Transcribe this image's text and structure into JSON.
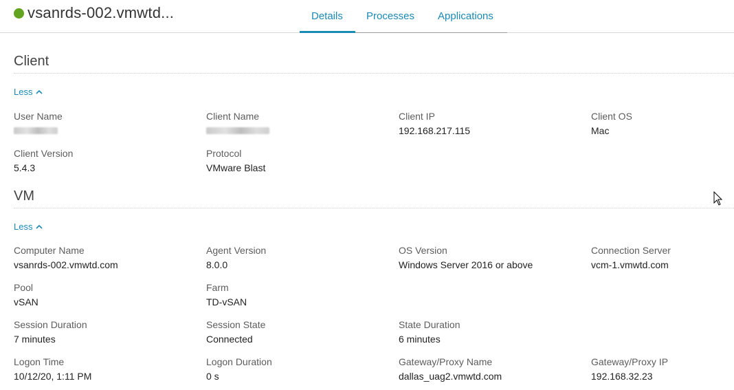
{
  "header": {
    "host_name": "vsanrds-002.vmwtd...",
    "status_color": "#62a420",
    "tabs": [
      {
        "label": "Details",
        "active": true
      },
      {
        "label": "Processes",
        "active": false
      },
      {
        "label": "Applications",
        "active": false
      }
    ]
  },
  "client": {
    "title": "Client",
    "toggle_label": "Less",
    "fields": {
      "user_name": {
        "label": "User Name",
        "value": ""
      },
      "client_name": {
        "label": "Client Name",
        "value": ""
      },
      "client_ip": {
        "label": "Client IP",
        "value": "192.168.217.115"
      },
      "client_os": {
        "label": "Client OS",
        "value": "Mac"
      },
      "client_version": {
        "label": "Client Version",
        "value": "5.4.3"
      },
      "protocol": {
        "label": "Protocol",
        "value": "VMware Blast"
      }
    }
  },
  "vm": {
    "title": "VM",
    "toggle_label": "Less",
    "fields": {
      "computer_name": {
        "label": "Computer Name",
        "value": "vsanrds-002.vmwtd.com"
      },
      "agent_version": {
        "label": "Agent Version",
        "value": "8.0.0"
      },
      "os_version": {
        "label": "OS Version",
        "value": "Windows Server 2016 or above"
      },
      "connection_server": {
        "label": "Connection Server",
        "value": "vcm-1.vmwtd.com"
      },
      "pool": {
        "label": "Pool",
        "value": "vSAN"
      },
      "farm": {
        "label": "Farm",
        "value": "TD-vSAN"
      },
      "session_duration": {
        "label": "Session Duration",
        "value": "7 minutes"
      },
      "session_state": {
        "label": "Session State",
        "value": "Connected"
      },
      "state_duration": {
        "label": "State Duration",
        "value": "6 minutes"
      },
      "logon_time": {
        "label": "Logon Time",
        "value": "10/12/20, 1:11 PM"
      },
      "logon_duration": {
        "label": "Logon Duration",
        "value": "0 s"
      },
      "gateway_name": {
        "label": "Gateway/Proxy Name",
        "value": "dallas_uag2.vmwtd.com"
      },
      "gateway_ip": {
        "label": "Gateway/Proxy IP",
        "value": "192.168.32.23"
      }
    }
  },
  "icons": {
    "status": "status-dot-icon",
    "toggle": "chevron-up-icon",
    "cursor": "mouse-pointer-icon"
  }
}
